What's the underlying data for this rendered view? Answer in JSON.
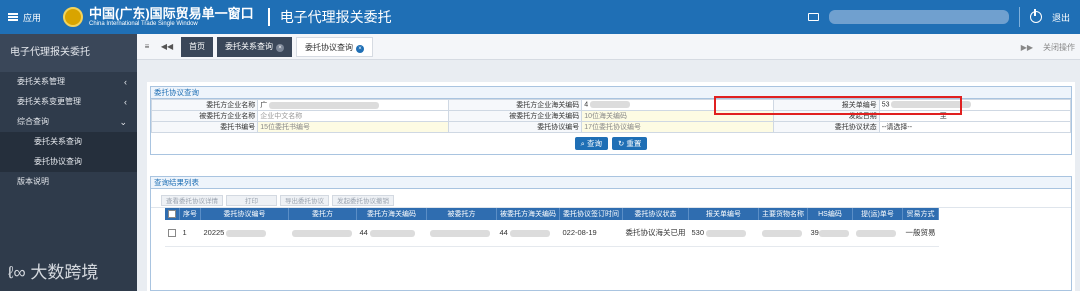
{
  "header": {
    "menu_label": "应用",
    "logo_cn": "中国(广东)国际贸易单一窗口",
    "logo_en": "China International Trade Single Window",
    "system_title": "电子代理报关委托",
    "logout_label": "退出"
  },
  "sidebar": {
    "title": "电子代理报关委托",
    "items": [
      {
        "label": "委托关系管理",
        "chevron": "‹"
      },
      {
        "label": "委托关系变更管理",
        "chevron": "‹"
      },
      {
        "label": "综合查询",
        "chevron": "⌄"
      }
    ],
    "subitems": [
      {
        "label": "委托关系查询"
      },
      {
        "label": "委托协议查询"
      }
    ],
    "extra_item": "版本说明",
    "watermark": "大数跨境"
  },
  "tabs": {
    "home": "首页",
    "items": [
      {
        "label": "委托关系查询"
      },
      {
        "label": "委托协议查询"
      }
    ],
    "close_ops": "关闭操作"
  },
  "query": {
    "title": "委托协议查询",
    "row1": {
      "l1": "委托方企业名称",
      "v1": "广",
      "l2": "委托方企业海关编码",
      "v2": "4",
      "l3": "报关单编号",
      "v3": "53"
    },
    "row2": {
      "l1": "被委托方企业名称",
      "v1": "企业中文名称",
      "l2": "被委托方企业海关编码",
      "v2": "10位海关编码",
      "l3": "发起日期",
      "v3_to": "至"
    },
    "row3": {
      "l1": "委托书编号",
      "v1": "15位委托书编号",
      "l2": "委托协议编号",
      "v2": "17位委托协议编号",
      "l3": "委托协议状态",
      "v3": "--请选择--"
    },
    "search_btn": "查询",
    "reset_btn": "重置"
  },
  "results": {
    "title": "查询结果列表",
    "toolbar": [
      "查看委托协议详情",
      "打印",
      "导出委托协议",
      "发起委托协议撤销"
    ],
    "columns": [
      "序号",
      "委托协议编号",
      "委托方",
      "委托方海关编码",
      "被委托方",
      "被委托方海关编码",
      "委托协议签订时间",
      "委托协议状态",
      "报关单编号",
      "主要货物名称",
      "HS编码",
      "提(运)单号",
      "贸易方式"
    ],
    "rows": [
      {
        "index": "1",
        "agreement_no": "20225",
        "client": "",
        "client_code": "44",
        "agent": "",
        "agent_code": "44",
        "sign_time": "022-08-19",
        "status": "委托协议海关已用",
        "declaration_no": "530",
        "goods": "",
        "hs_code": "39",
        "bill_no": "",
        "trade_mode": "一般贸易"
      }
    ]
  }
}
